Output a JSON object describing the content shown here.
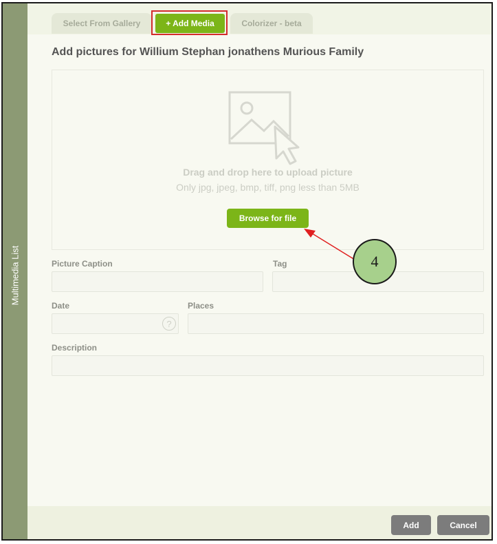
{
  "sidebar": {
    "label": "Multimedia List"
  },
  "tabs": [
    {
      "label": "Select From Gallery",
      "active": false
    },
    {
      "label": "+ Add Media",
      "active": true
    },
    {
      "label": "Colorizer - beta",
      "active": false
    }
  ],
  "main": {
    "title": "Add pictures for Willium Stephan jonathens Murious Family",
    "dropzone": {
      "title": "Drag and drop here to upload picture",
      "hint": "Only jpg, jpeg, bmp, tiff, png less than 5MB",
      "browse_label": "Browse for file",
      "icon": "image-upload-icon"
    },
    "fields": {
      "caption_label": "Picture Caption",
      "caption_value": "",
      "tag_label": "Tag",
      "tag_value": "",
      "date_label": "Date",
      "date_value": "",
      "date_help": "?",
      "places_label": "Places",
      "places_value": "",
      "description_label": "Description",
      "description_value": ""
    }
  },
  "footer": {
    "add_label": "Add",
    "cancel_label": "Cancel"
  },
  "annotation": {
    "step_number": "4"
  },
  "colors": {
    "accent": "#7cb518",
    "sidebar": "#8c9a74",
    "callout_fill": "#a7d08c",
    "callout_arrow": "#e02020",
    "highlight_box": "#d42b2b",
    "footer_button": "#7c7c7c"
  }
}
